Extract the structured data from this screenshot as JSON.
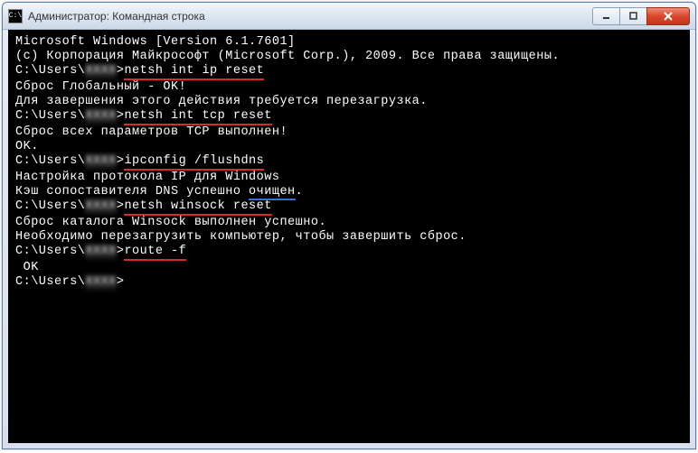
{
  "titlebar": {
    "icon_text": "C:\\",
    "title": "Администратор: Командная строка",
    "minimize_label": "–",
    "maximize_label": "▢",
    "close_label": "✕"
  },
  "terminal": {
    "header1": "Microsoft Windows [Version 6.1.7601]",
    "header2": "(c) Корпорация Майкрософт (Microsoft Corp.), 2009. Все права защищены.",
    "blank": "",
    "prompt_prefix": "C:\\Users\\",
    "user_blur": "XXXX",
    "prompt_suffix": ">",
    "cmd1": "netsh int ip reset",
    "out1a": "Сброс Глобальный - OK!",
    "out1b": "Для завершения этого действия требуется перезагрузка.",
    "cmd2": "netsh int tcp reset",
    "out2a": "Сброс всех параметров TCP выполнен!",
    "out2b": "OK.",
    "cmd3": "ipconfig /flushdns",
    "out3a": "Настройка протокола IP для Windows",
    "out3b_pre": "Кэш сопоставителя DNS успешно ",
    "out3b_hl": "очищен",
    "out3b_post": ".",
    "cmd4": "netsh winsock reset",
    "out4a": "Сброс каталога Winsock выполнен успешно.",
    "out4b": "Необходимо перезагрузить компьютер, чтобы завершить сброс.",
    "cmd5": "route -f",
    "out5a": " OK"
  }
}
